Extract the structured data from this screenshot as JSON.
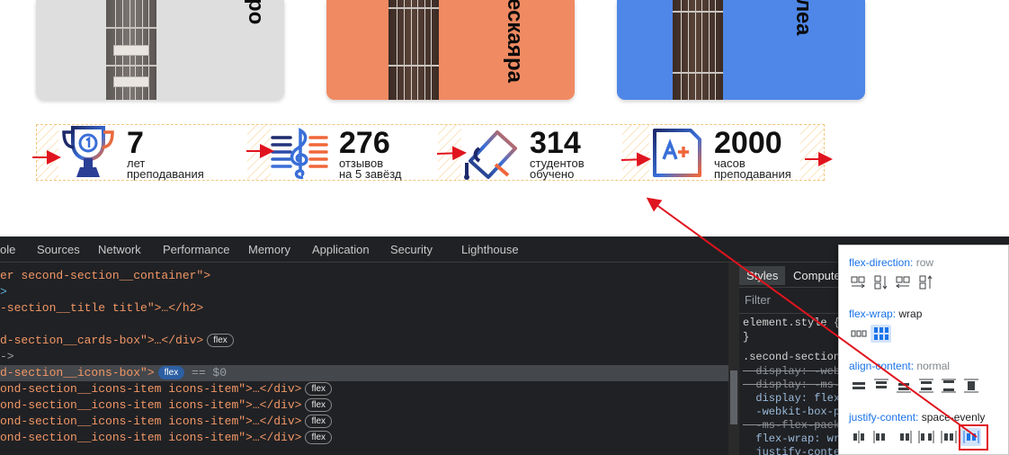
{
  "cards": [
    {
      "title_lines": [
        "ро",
        ""
      ],
      "color": "#dedede"
    },
    {
      "title_lines": [
        "еская",
        "ра"
      ],
      "color": "#f08a62"
    },
    {
      "title_lines": [
        "ле",
        "а"
      ],
      "color": "#4f87e8"
    }
  ],
  "icons_items": [
    {
      "icon": "trophy-icon",
      "number": "7",
      "line1": "лет",
      "line2": "преподавания"
    },
    {
      "icon": "treble-clef-icon",
      "number": "276",
      "line1": "отзывов",
      "line2": "на 5 завёзд"
    },
    {
      "icon": "graduation-cap-icon",
      "number": "314",
      "line1": "студентов",
      "line2": "обучено"
    },
    {
      "icon": "grade-a-plus-icon",
      "number": "2000",
      "line1": "часов",
      "line2": "преподавания"
    }
  ],
  "devtools": {
    "tabs": [
      "ole",
      "Sources",
      "Network",
      "Performance",
      "Memory",
      "Application",
      "Security",
      "Lighthouse"
    ],
    "dom_lines": {
      "l0": "er second-section__container\">",
      "l1": ">",
      "l2": "-section__title title\">…</h2>",
      "l3": "d-section__cards-box\">…</div>",
      "l4": "->",
      "l5": "d-section__icons-box\">",
      "l6": "ond-section__icons-item icons-item\">…</div>",
      "l7": "ond-section__icons-item icons-item\">…</div>",
      "l8": "ond-section__icons-item icons-item\">…</div>",
      "l9": "ond-section__icons-item icons-item\">…</div>"
    },
    "badge_flex": "flex",
    "selected_suffix": "== $0",
    "styles_tab": "Styles",
    "computed_tab": "Compute",
    "filter_placeholder": "Filter",
    "css_lines": {
      "c0": "element.style {",
      "c1": "}",
      "c2": ".second-section",
      "c3": "  display: -webk",
      "c4": "  display: -ms-",
      "c5": "  display: flex",
      "c6": "  -webkit-box-p",
      "c7": "  -ms-flex-pack",
      "c8": "  flex-wrap: wr",
      "c9": "  justify-conte"
    }
  },
  "flex_editor": {
    "flex_direction_label": "flex-direction",
    "flex_direction_value": "row",
    "flex_wrap_label": "flex-wrap",
    "flex_wrap_value": "wrap",
    "align_content_label": "align-content",
    "align_content_value": "normal",
    "justify_content_label": "justify-content",
    "justify_content_value": "space-evenly"
  },
  "colors": {
    "accent_red": "#e0141e",
    "devtools_bg": "#202124",
    "link_blue": "#1a73e8"
  }
}
